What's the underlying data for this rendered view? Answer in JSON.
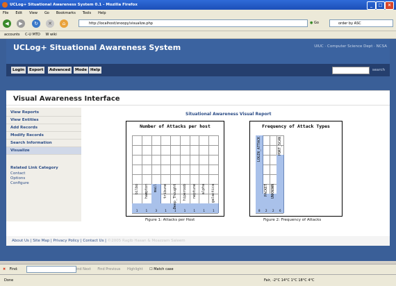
{
  "window": {
    "title": "UCLog+ Situational Awareness System 0.1 - Mozilla Firefox"
  },
  "menu": [
    "File",
    "Edit",
    "View",
    "Go",
    "Bookmarks",
    "Tools",
    "Help"
  ],
  "browser": {
    "url": "http://localhost/snoopy/visualize.php",
    "go_label": "Go",
    "search_value": "order by ASC",
    "bookmarks": [
      "accounts",
      "C-U MTD",
      "W wiki"
    ]
  },
  "app": {
    "title": "UCLog+ Situational Awareness System",
    "depts": "UIUC · Computer Science Dept · NCSA",
    "nav": [
      "Login",
      "Export",
      "Advanced",
      "Mode",
      "Help"
    ],
    "search_label": "search"
  },
  "content": {
    "page_title": "Visual Awareness Interface",
    "report_title": "Situational Awareness Visual Report"
  },
  "sidebar": {
    "items": [
      "View Reports",
      "View Entities",
      "Add Records",
      "Modify Records",
      "Search Information",
      "Visualize"
    ],
    "related_heading": "Related Link Category",
    "related_links": [
      "Contact",
      "Options",
      "Configure"
    ]
  },
  "chart_data": [
    {
      "type": "bar",
      "title": "Number of Attacks per host",
      "categories": [
        "bilbo",
        "hampton",
        "mail",
        "tribune",
        "Deep_Thought",
        "hiperoob",
        "neptune",
        "alpha",
        "galactica"
      ],
      "values": [
        1,
        1,
        3,
        1,
        1,
        1,
        1,
        1,
        1
      ],
      "caption": "Figure 1: Attacks per Host"
    },
    {
      "type": "bar",
      "title": "Frequency of Attack Types",
      "categories": [
        "LOGIN_ATTACK",
        "PACKET",
        "UNKNOWN",
        "PORT_SCAN"
      ],
      "values": [
        8,
        2,
        2,
        6
      ],
      "caption": "Figure 2: Frequency of Attacks"
    }
  ],
  "footer": {
    "links": [
      "About Us",
      "Site Map",
      "Privacy Policy",
      "Contact Us"
    ],
    "copyright": "©2005 Ragib Hasan & Moazzam Saleem"
  },
  "findbar": {
    "label": "Find:",
    "next": "Find Next",
    "previous": "Find Previous",
    "highlight": "Highlight",
    "match_case": "Match case"
  },
  "status": {
    "left": "Done",
    "weather": "Fair, -2°C    14°C    1°C    18°C    4°C"
  }
}
